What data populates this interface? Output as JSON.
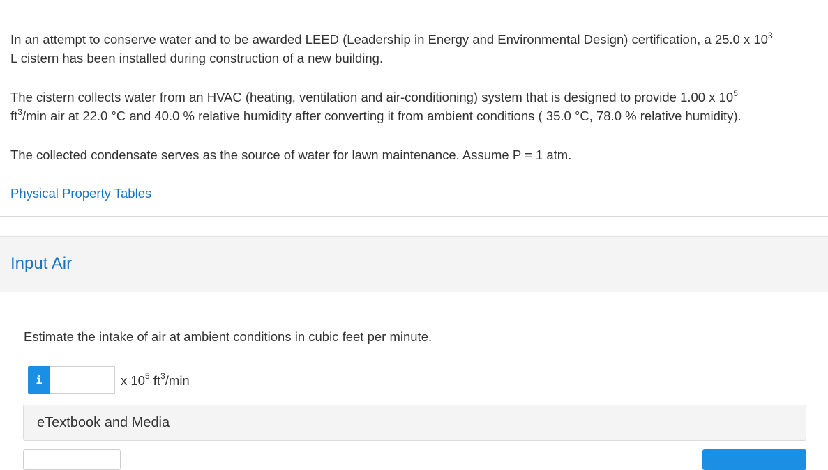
{
  "problem": {
    "p1_part1": "In an attempt to conserve water and to be awarded LEED (Leadership in Energy and Environmental Design) certification, a 25.0 x 10",
    "p1_sup": "3",
    "p1_part2": "L cistern has been installed during construction of a new building.",
    "p2_part1": "The cistern collects water from an HVAC (heating, ventilation and air-conditioning) system that is designed to provide 1.00 x 10",
    "p2_sup1": "5",
    "p2_part2": "ft",
    "p2_sup2": "3",
    "p2_part3": "/min air at 22.0 °C and 40.0 % relative humidity after converting it from ambient conditions ( 35.0 °C, 78.0 % relative humidity).",
    "p3": "The collected condensate serves as the source of water for lawn maintenance. Assume P = 1 atm."
  },
  "link": {
    "label": "Physical Property Tables"
  },
  "section": {
    "title": "Input Air"
  },
  "question": {
    "text": "Estimate the intake of air at ambient conditions in cubic feet per minute."
  },
  "answer": {
    "info_label": "i",
    "value": "",
    "unit_part1": "x 10",
    "unit_sup1": "5",
    "unit_part2": " ft",
    "unit_sup2": "3",
    "unit_part3": "/min"
  },
  "etextbook": {
    "label": "eTextbook and Media"
  },
  "colors": {
    "accent": "#1a73c1",
    "button": "#1a8fe3"
  }
}
